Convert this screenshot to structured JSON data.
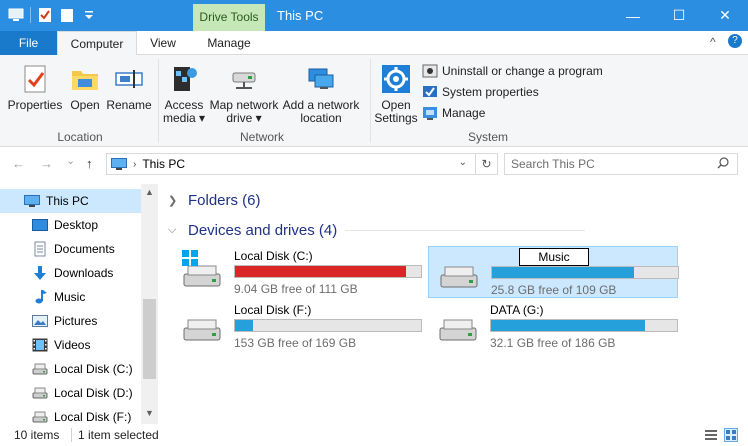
{
  "window": {
    "contextual_tab": "Drive Tools",
    "title": "This PC",
    "controls": {
      "minimize": "—",
      "maximize": "☐",
      "close": "✕"
    }
  },
  "ribbon_tabs": {
    "file": "File",
    "computer": "Computer",
    "view": "View",
    "manage": "Manage",
    "collapse": "^",
    "help": "?"
  },
  "ribbon": {
    "location": {
      "label": "Location",
      "properties": "Properties",
      "open": "Open",
      "rename": "Rename"
    },
    "network": {
      "label": "Network",
      "access_media_1": "Access",
      "access_media_2": "media ▾",
      "map_drive_1": "Map network",
      "map_drive_2": "drive ▾",
      "add_location_1": "Add a network",
      "add_location_2": "location"
    },
    "system": {
      "label": "System",
      "open_settings_1": "Open",
      "open_settings_2": "Settings",
      "uninstall": "Uninstall or change a program",
      "system_properties": "System properties",
      "manage": "Manage"
    }
  },
  "navigation": {
    "back": "←",
    "forward": "→",
    "recent": "⌄",
    "up": "↑",
    "address_chevron": "›",
    "address": "This PC",
    "dropdown": "⌄",
    "refresh": "↻",
    "search_placeholder": "Search This PC"
  },
  "nav_pane": {
    "items": [
      {
        "label": "This PC",
        "icon": "pc-icon",
        "selected": true
      },
      {
        "label": "Desktop",
        "icon": "desktop-icon"
      },
      {
        "label": "Documents",
        "icon": "documents-icon"
      },
      {
        "label": "Downloads",
        "icon": "downloads-icon"
      },
      {
        "label": "Music",
        "icon": "music-icon"
      },
      {
        "label": "Pictures",
        "icon": "pictures-icon"
      },
      {
        "label": "Videos",
        "icon": "videos-icon"
      },
      {
        "label": "Local Disk (C:)",
        "icon": "drive-icon"
      },
      {
        "label": "Local Disk (D:)",
        "icon": "drive-icon"
      },
      {
        "label": "Local Disk (F:)",
        "icon": "drive-icon"
      }
    ]
  },
  "content": {
    "folders_header": "Folders (6)",
    "devices_header": "Devices and drives (4)",
    "drives": [
      {
        "name": "Local Disk (C:)",
        "free_text": "9.04 GB free of 111 GB",
        "used_fraction": 0.919,
        "bar_color": "#da2626",
        "os": true
      },
      {
        "name": "Music",
        "free_text": "25.8 GB free of 109 GB",
        "used_fraction": 0.763,
        "bar_color": "#26a0da",
        "selected": true,
        "renaming": true
      },
      {
        "name": "Local Disk (F:)",
        "free_text": "153 GB free of 169 GB",
        "used_fraction": 0.095,
        "bar_color": "#26a0da"
      },
      {
        "name": "DATA (G:)",
        "free_text": "32.1 GB free of 186 GB",
        "used_fraction": 0.827,
        "bar_color": "#26a0da"
      }
    ]
  },
  "status": {
    "count": "10 items",
    "selected": "1 item selected"
  },
  "colors": {
    "titlebar": "#2b8ee0",
    "selection": "#cce8ff",
    "warning_bar": "#da2626",
    "normal_bar": "#26a0da"
  }
}
